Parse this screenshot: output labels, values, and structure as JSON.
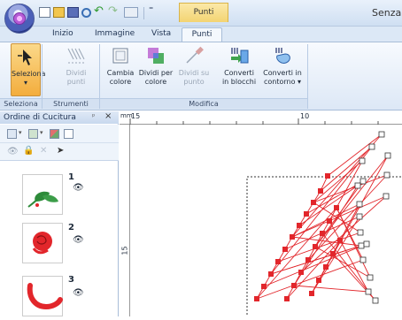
{
  "titlebar": {
    "context_tab": "Punti",
    "window_title": "Senza",
    "qat_icons": [
      "new-icon",
      "open-icon",
      "save-icon",
      "preview-icon",
      "undo-icon",
      "redo-icon",
      "paste-icon",
      "dropdown-icon"
    ]
  },
  "tabs": [
    "Inizio",
    "Immagine",
    "Vista",
    "Punti"
  ],
  "ribbon": {
    "seleziona": {
      "label1": "Seleziona",
      "arrow": "▾"
    },
    "dividi_punti": {
      "label1": "Dividi",
      "label2": "punti"
    },
    "cambia_colore": {
      "label1": "Cambia",
      "label2": "colore"
    },
    "dividi_colore": {
      "label1": "Dividi per",
      "label2": "colore"
    },
    "dividi_punto": {
      "label1": "Dividi su",
      "label2": "punto"
    },
    "converti_blocchi": {
      "label1": "Converti",
      "label2": "in blocchi"
    },
    "converti_contorno": {
      "label1": "Converti in",
      "label2": "contorno ▾"
    },
    "groups": [
      "Seleziona",
      "Strumenti",
      "Modifica"
    ]
  },
  "panel": {
    "title": "Ordine di Cucitura",
    "pin": "ᵖ",
    "close": "×",
    "items": [
      {
        "number": "1",
        "eye": "👁"
      },
      {
        "number": "2",
        "eye": "👁"
      },
      {
        "number": "3",
        "eye": "👁"
      }
    ]
  },
  "ruler": {
    "unit": "mm",
    "top_labels": [
      "15",
      "10"
    ],
    "left_label": "15"
  },
  "colors": {
    "stitch_red": "#e2262b",
    "leaf_green": "#2e8b3a",
    "accent_orange": "#f3ad3d"
  }
}
